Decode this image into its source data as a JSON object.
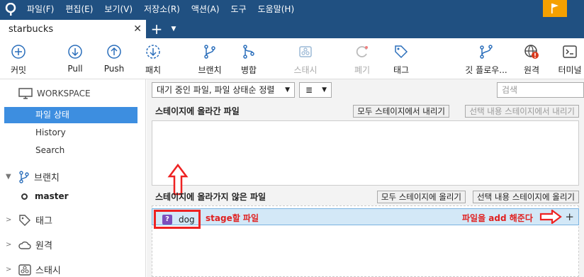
{
  "menu": [
    "파일(F)",
    "편집(E)",
    "보기(V)",
    "저장소(R)",
    "액션(A)",
    "도구",
    "도움말(H)"
  ],
  "tab": {
    "title": "starbucks",
    "close": "✕",
    "add": "+",
    "menu": "▼"
  },
  "toolbar": {
    "commit": "커밋",
    "pull": "Pull",
    "push": "Push",
    "fetch": "패치",
    "branch": "브랜치",
    "merge": "병합",
    "stash": "스태시",
    "discard": "폐기",
    "tag": "태그",
    "git_flow": "깃 플로우...",
    "remote": "원격",
    "terminal": "터미널"
  },
  "sidebar": {
    "workspace": "WORKSPACE",
    "file_status": "파일 상태",
    "history": "History",
    "search": "Search",
    "branches": "브랜치",
    "master": "master",
    "tags": "태그",
    "remotes": "원격",
    "stashes": "스태시"
  },
  "filter": {
    "value": "대기 중인 파일, 파일 상태순 정렬",
    "view": "≣"
  },
  "search": {
    "placeholder": "검색"
  },
  "staged": {
    "header": "스테이지에 올라간 파일",
    "unstage_all": "모두 스테이지에서 내리기",
    "unstage_selected": "선택 내용 스테이지에서 내리기"
  },
  "unstaged": {
    "header": "스테이지에 올라가지 않은 파일",
    "stage_all": "모두 스테이지에 올리기",
    "stage_selected": "선택 내용 스테이지에 올리기",
    "files": [
      {
        "name": "dog",
        "status": "?"
      }
    ]
  },
  "annotations": {
    "stage_file": "stage할 파일",
    "add_hint": "파일을 add 해준다"
  },
  "colors": {
    "header": "#205081",
    "accent": "#3d8ee0",
    "annotation": "#e02020",
    "flag": "#f5a000"
  }
}
